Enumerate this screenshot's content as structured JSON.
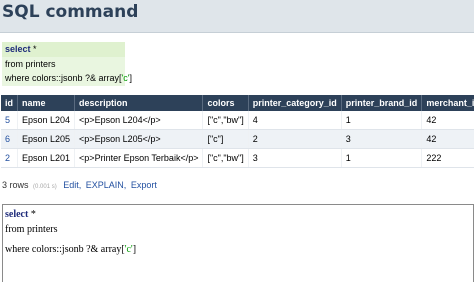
{
  "page": {
    "title": "SQL command"
  },
  "query": {
    "select_kw": "select",
    "select_rest": " *",
    "line2": "from printers",
    "line3_a": "where colors::jsonb ?& array[",
    "line3_str": "'c'",
    "line3_b": "]"
  },
  "table": {
    "columns": [
      "id",
      "name",
      "description",
      "colors",
      "printer_category_id",
      "printer_brand_id",
      "merchant_id"
    ],
    "rows": [
      {
        "id": "5",
        "name": "Epson L204",
        "description": "<p>Epson L204</p>",
        "colors": "[\"c\",\"bw\"]",
        "printer_category_id": "4",
        "printer_brand_id": "1",
        "merchant_id": "42"
      },
      {
        "id": "6",
        "name": "Epson L205",
        "description": "<p>Epson L205</p>",
        "colors": "[\"c\"]",
        "printer_category_id": "2",
        "printer_brand_id": "3",
        "merchant_id": "42"
      },
      {
        "id": "2",
        "name": "Epson L201",
        "description": "<p>Printer Epson Terbaik</p>",
        "colors": "[\"c\",\"bw\"]",
        "printer_category_id": "3",
        "printer_brand_id": "1",
        "merchant_id": "222"
      }
    ]
  },
  "summary": {
    "rows_text": "3 rows",
    "time_text": "(0.001 s)",
    "edit_label": "Edit,",
    "explain_label": "EXPLAIN,",
    "export_label": "Export"
  },
  "editor": {
    "select_kw": "select",
    "select_rest": " *",
    "line2": "from printers",
    "line3_a": "where colors::jsonb ?& array[",
    "line3_str": "'c'",
    "line3_b": "]"
  }
}
